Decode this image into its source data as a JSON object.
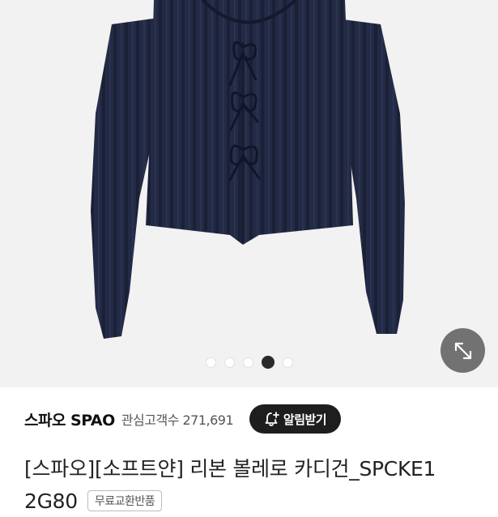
{
  "carousel": {
    "slide_count": 5,
    "active_index": 3
  },
  "product_image": {
    "subject": "navy ribbed cardigan with ribbon ties",
    "garment_color": "#232a45",
    "background_color": "#f2f2f2"
  },
  "expand_button": {
    "icon": "expand-arrows-icon"
  },
  "brand": {
    "name": "스파오 SPAO",
    "interest_label": "관심고객수 271,691"
  },
  "notify_button": {
    "icon": "bell-plus-icon",
    "label": "알림받기"
  },
  "product": {
    "title_line1": "[스파오][소프트얀] 리본 볼레로 카디건_SPCKE1",
    "title_line2": "2G80",
    "badge": "무료교환반품"
  }
}
